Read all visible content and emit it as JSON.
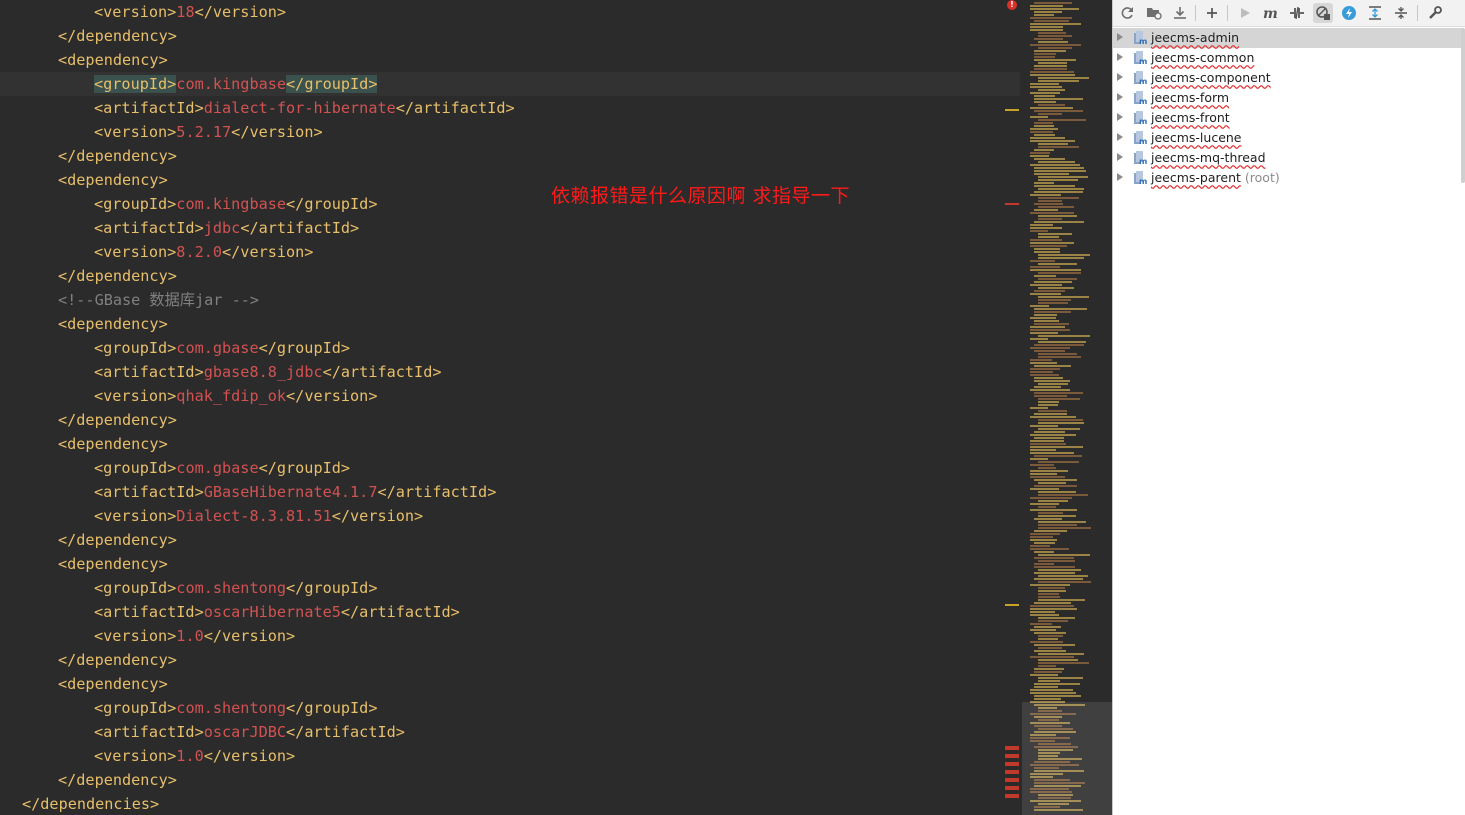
{
  "editor": {
    "lines": [
      {
        "indent": 2,
        "open": "<version>",
        "text": "18",
        "close": "</version>"
      },
      {
        "indent": 1,
        "open": "</dependency>",
        "text": "",
        "close": ""
      },
      {
        "indent": 1,
        "open": "<dependency>",
        "text": "",
        "close": ""
      },
      {
        "indent": 2,
        "open": "<groupId>",
        "text": "com.kingbase",
        "close": "</groupId>",
        "current": true,
        "highlight_tags": true
      },
      {
        "indent": 2,
        "open": "<artifactId>",
        "text": "dialect-for-hibernate",
        "close": "</artifactId>"
      },
      {
        "indent": 2,
        "open": "<version>",
        "text": "5.2.17",
        "close": "</version>"
      },
      {
        "indent": 1,
        "open": "</dependency>",
        "text": "",
        "close": ""
      },
      {
        "indent": 1,
        "open": "<dependency>",
        "text": "",
        "close": ""
      },
      {
        "indent": 2,
        "open": "<groupId>",
        "text": "com.kingbase",
        "close": "</groupId>"
      },
      {
        "indent": 2,
        "open": "<artifactId>",
        "text": "jdbc",
        "close": "</artifactId>"
      },
      {
        "indent": 2,
        "open": "<version>",
        "text": "8.2.0",
        "close": "</version>"
      },
      {
        "indent": 1,
        "open": "</dependency>",
        "text": "",
        "close": ""
      },
      {
        "indent": 1,
        "open": "<!--GBase 数据库jar -->",
        "text": "",
        "close": "",
        "comment": true
      },
      {
        "indent": 1,
        "open": "<dependency>",
        "text": "",
        "close": ""
      },
      {
        "indent": 2,
        "open": "<groupId>",
        "text": "com.gbase",
        "close": "</groupId>"
      },
      {
        "indent": 2,
        "open": "<artifactId>",
        "text": "gbase8.8_jdbc",
        "close": "</artifactId>"
      },
      {
        "indent": 2,
        "open": "<version>",
        "text": "qhak_fdip_ok",
        "close": "</version>"
      },
      {
        "indent": 1,
        "open": "</dependency>",
        "text": "",
        "close": ""
      },
      {
        "indent": 1,
        "open": "<dependency>",
        "text": "",
        "close": ""
      },
      {
        "indent": 2,
        "open": "<groupId>",
        "text": "com.gbase",
        "close": "</groupId>"
      },
      {
        "indent": 2,
        "open": "<artifactId>",
        "text": "GBaseHibernate4.1.7",
        "close": "</artifactId>"
      },
      {
        "indent": 2,
        "open": "<version>",
        "text": "Dialect-8.3.81.51",
        "close": "</version>"
      },
      {
        "indent": 1,
        "open": "</dependency>",
        "text": "",
        "close": ""
      },
      {
        "indent": 1,
        "open": "<dependency>",
        "text": "",
        "close": ""
      },
      {
        "indent": 2,
        "open": "<groupId>",
        "text": "com.shentong",
        "close": "</groupId>"
      },
      {
        "indent": 2,
        "open": "<artifactId>",
        "text": "oscarHibernate5",
        "close": "</artifactId>"
      },
      {
        "indent": 2,
        "open": "<version>",
        "text": "1.0",
        "close": "</version>"
      },
      {
        "indent": 1,
        "open": "</dependency>",
        "text": "",
        "close": ""
      },
      {
        "indent": 1,
        "open": "<dependency>",
        "text": "",
        "close": ""
      },
      {
        "indent": 2,
        "open": "<groupId>",
        "text": "com.shentong",
        "close": "</groupId>"
      },
      {
        "indent": 2,
        "open": "<artifactId>",
        "text": "oscarJDBC",
        "close": "</artifactId>"
      },
      {
        "indent": 2,
        "open": "<version>",
        "text": "1.0",
        "close": "</version>"
      },
      {
        "indent": 1,
        "open": "</dependency>",
        "text": "",
        "close": ""
      },
      {
        "indent": 0,
        "open": "</dependencies>",
        "text": "",
        "close": ""
      }
    ],
    "question_overlay": "依赖报错是什么原因啊 求指导一下",
    "error_icon": "!"
  },
  "maven_panel": {
    "toolbar_icons": [
      "reload-icon",
      "generate-sources-icon",
      "download-icon",
      "add-icon",
      "run-icon",
      "maven-goal-icon",
      "toggle-offline-icon",
      "skip-tests-icon",
      "show-dependencies-icon",
      "expand-all-icon",
      "collapse-all-icon",
      "settings-wrench-icon"
    ],
    "projects": [
      {
        "name": "jeecms-admin",
        "hint": "",
        "selected": true
      },
      {
        "name": "jeecms-common",
        "hint": ""
      },
      {
        "name": "jeecms-component",
        "hint": ""
      },
      {
        "name": "jeecms-form",
        "hint": ""
      },
      {
        "name": "jeecms-front",
        "hint": ""
      },
      {
        "name": "jeecms-lucene",
        "hint": ""
      },
      {
        "name": "jeecms-mq-thread",
        "hint": ""
      },
      {
        "name": "jeecms-parent",
        "hint": "(root)"
      }
    ]
  },
  "colors": {
    "tag": "#e8bf6a",
    "value": "#d25252",
    "comment": "#808080",
    "overlay_text": "#ff1a1a",
    "editor_bg": "#2b2b2b",
    "panel_bg": "#ffffff"
  }
}
